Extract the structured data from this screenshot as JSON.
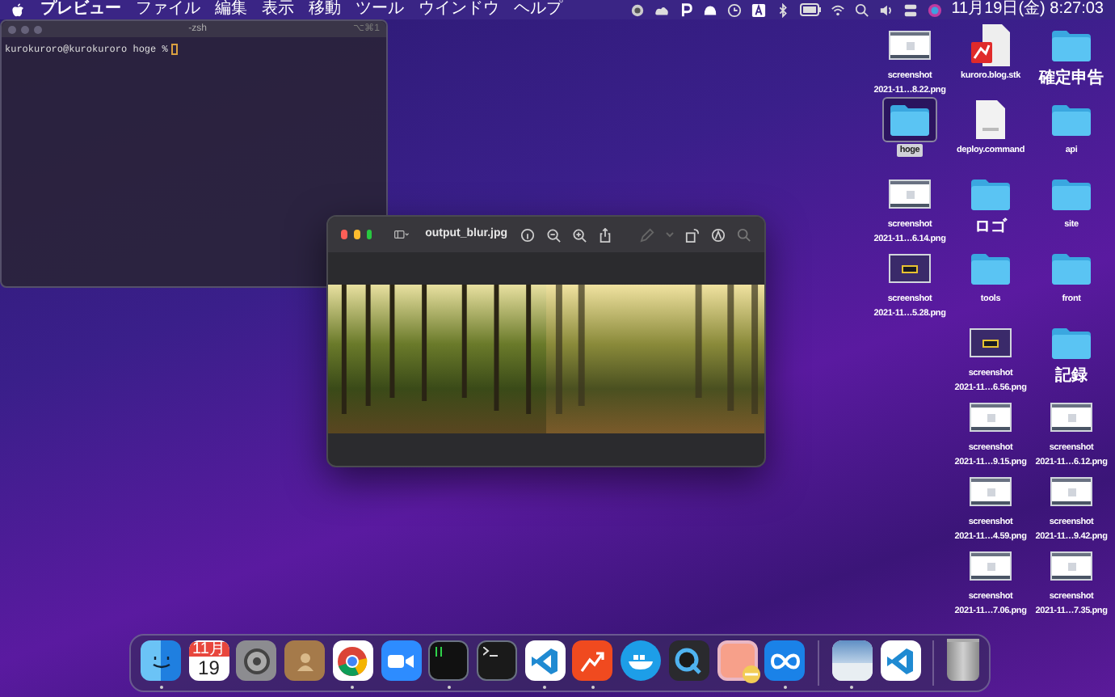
{
  "menubar": {
    "app_name": "プレビュー",
    "menus": [
      "ファイル",
      "編集",
      "表示",
      "移動",
      "ツール",
      "ウインドウ",
      "ヘルプ"
    ],
    "clock": "11月19日(金) 8:27:03"
  },
  "terminal": {
    "title": "-zsh",
    "shortcut": "⌥⌘1",
    "prompt": "kurokuroro@kurokuroro hoge %"
  },
  "preview": {
    "title": "output_blur.jpg"
  },
  "desktop_columns": [
    [
      {
        "kind": "screenshot",
        "lines": [
          "screenshot",
          "2021-11…8.22.png"
        ],
        "selected": false
      },
      {
        "kind": "folder",
        "lines": [
          "hoge"
        ],
        "selected": true
      },
      {
        "kind": "screenshot",
        "lines": [
          "screenshot",
          "2021-11…6.14.png"
        ],
        "selected": false
      },
      {
        "kind": "dark-screenshot",
        "lines": [
          "screenshot",
          "2021-11…5.28.png"
        ],
        "selected": false
      }
    ],
    [
      {
        "kind": "stk",
        "lines": [
          "kuroro.blog.stk"
        ],
        "selected": false
      },
      {
        "kind": "shell",
        "lines": [
          "deploy.command"
        ],
        "selected": false
      },
      {
        "kind": "folder",
        "lines": [
          "ロゴ"
        ],
        "selected": false
      },
      {
        "kind": "folder",
        "lines": [
          "tools"
        ],
        "selected": false
      },
      {
        "kind": "dark-screenshot",
        "lines": [
          "screenshot",
          "2021-11…6.56.png"
        ],
        "selected": false
      },
      {
        "kind": "screenshot",
        "lines": [
          "screenshot",
          "2021-11…9.15.png"
        ],
        "selected": false
      },
      {
        "kind": "screenshot",
        "lines": [
          "screenshot",
          "2021-11…4.59.png"
        ],
        "selected": false
      },
      {
        "kind": "screenshot",
        "lines": [
          "screenshot",
          "2021-11…7.06.png"
        ],
        "selected": false
      }
    ],
    [
      {
        "kind": "folder",
        "lines": [
          "確定申告"
        ],
        "selected": false
      },
      {
        "kind": "folder",
        "lines": [
          "api"
        ],
        "selected": false
      },
      {
        "kind": "folder",
        "lines": [
          "site"
        ],
        "selected": false
      },
      {
        "kind": "folder",
        "lines": [
          "front"
        ],
        "selected": false
      },
      {
        "kind": "folder",
        "lines": [
          "記録"
        ],
        "selected": false
      },
      {
        "kind": "screenshot",
        "lines": [
          "screenshot",
          "2021-11…6.12.png"
        ],
        "selected": false
      },
      {
        "kind": "screenshot",
        "lines": [
          "screenshot",
          "2021-11…9.42.png"
        ],
        "selected": false
      },
      {
        "kind": "screenshot",
        "lines": [
          "screenshot",
          "2021-11…7.35.png"
        ],
        "selected": false
      }
    ]
  ],
  "dock": {
    "items": [
      {
        "kind": "finder",
        "running": true
      },
      {
        "kind": "calendar",
        "month": "11月",
        "day": "19",
        "running": false
      },
      {
        "kind": "settings",
        "running": false
      },
      {
        "kind": "contacts",
        "running": false
      },
      {
        "kind": "chrome",
        "running": true
      },
      {
        "kind": "video",
        "running": false
      },
      {
        "kind": "iterm",
        "running": true
      },
      {
        "kind": "terminal",
        "running": false
      },
      {
        "kind": "code",
        "running": true
      },
      {
        "kind": "arrow",
        "running": true
      },
      {
        "kind": "whale",
        "running": false
      },
      {
        "kind": "quicktime",
        "running": false
      },
      {
        "kind": "pink",
        "running": false
      },
      {
        "kind": "infinity",
        "running": true
      },
      {
        "kind": "divider"
      },
      {
        "kind": "photo",
        "running": true
      },
      {
        "kind": "code",
        "running": false
      },
      {
        "kind": "divider"
      },
      {
        "kind": "trash",
        "running": false
      }
    ]
  }
}
